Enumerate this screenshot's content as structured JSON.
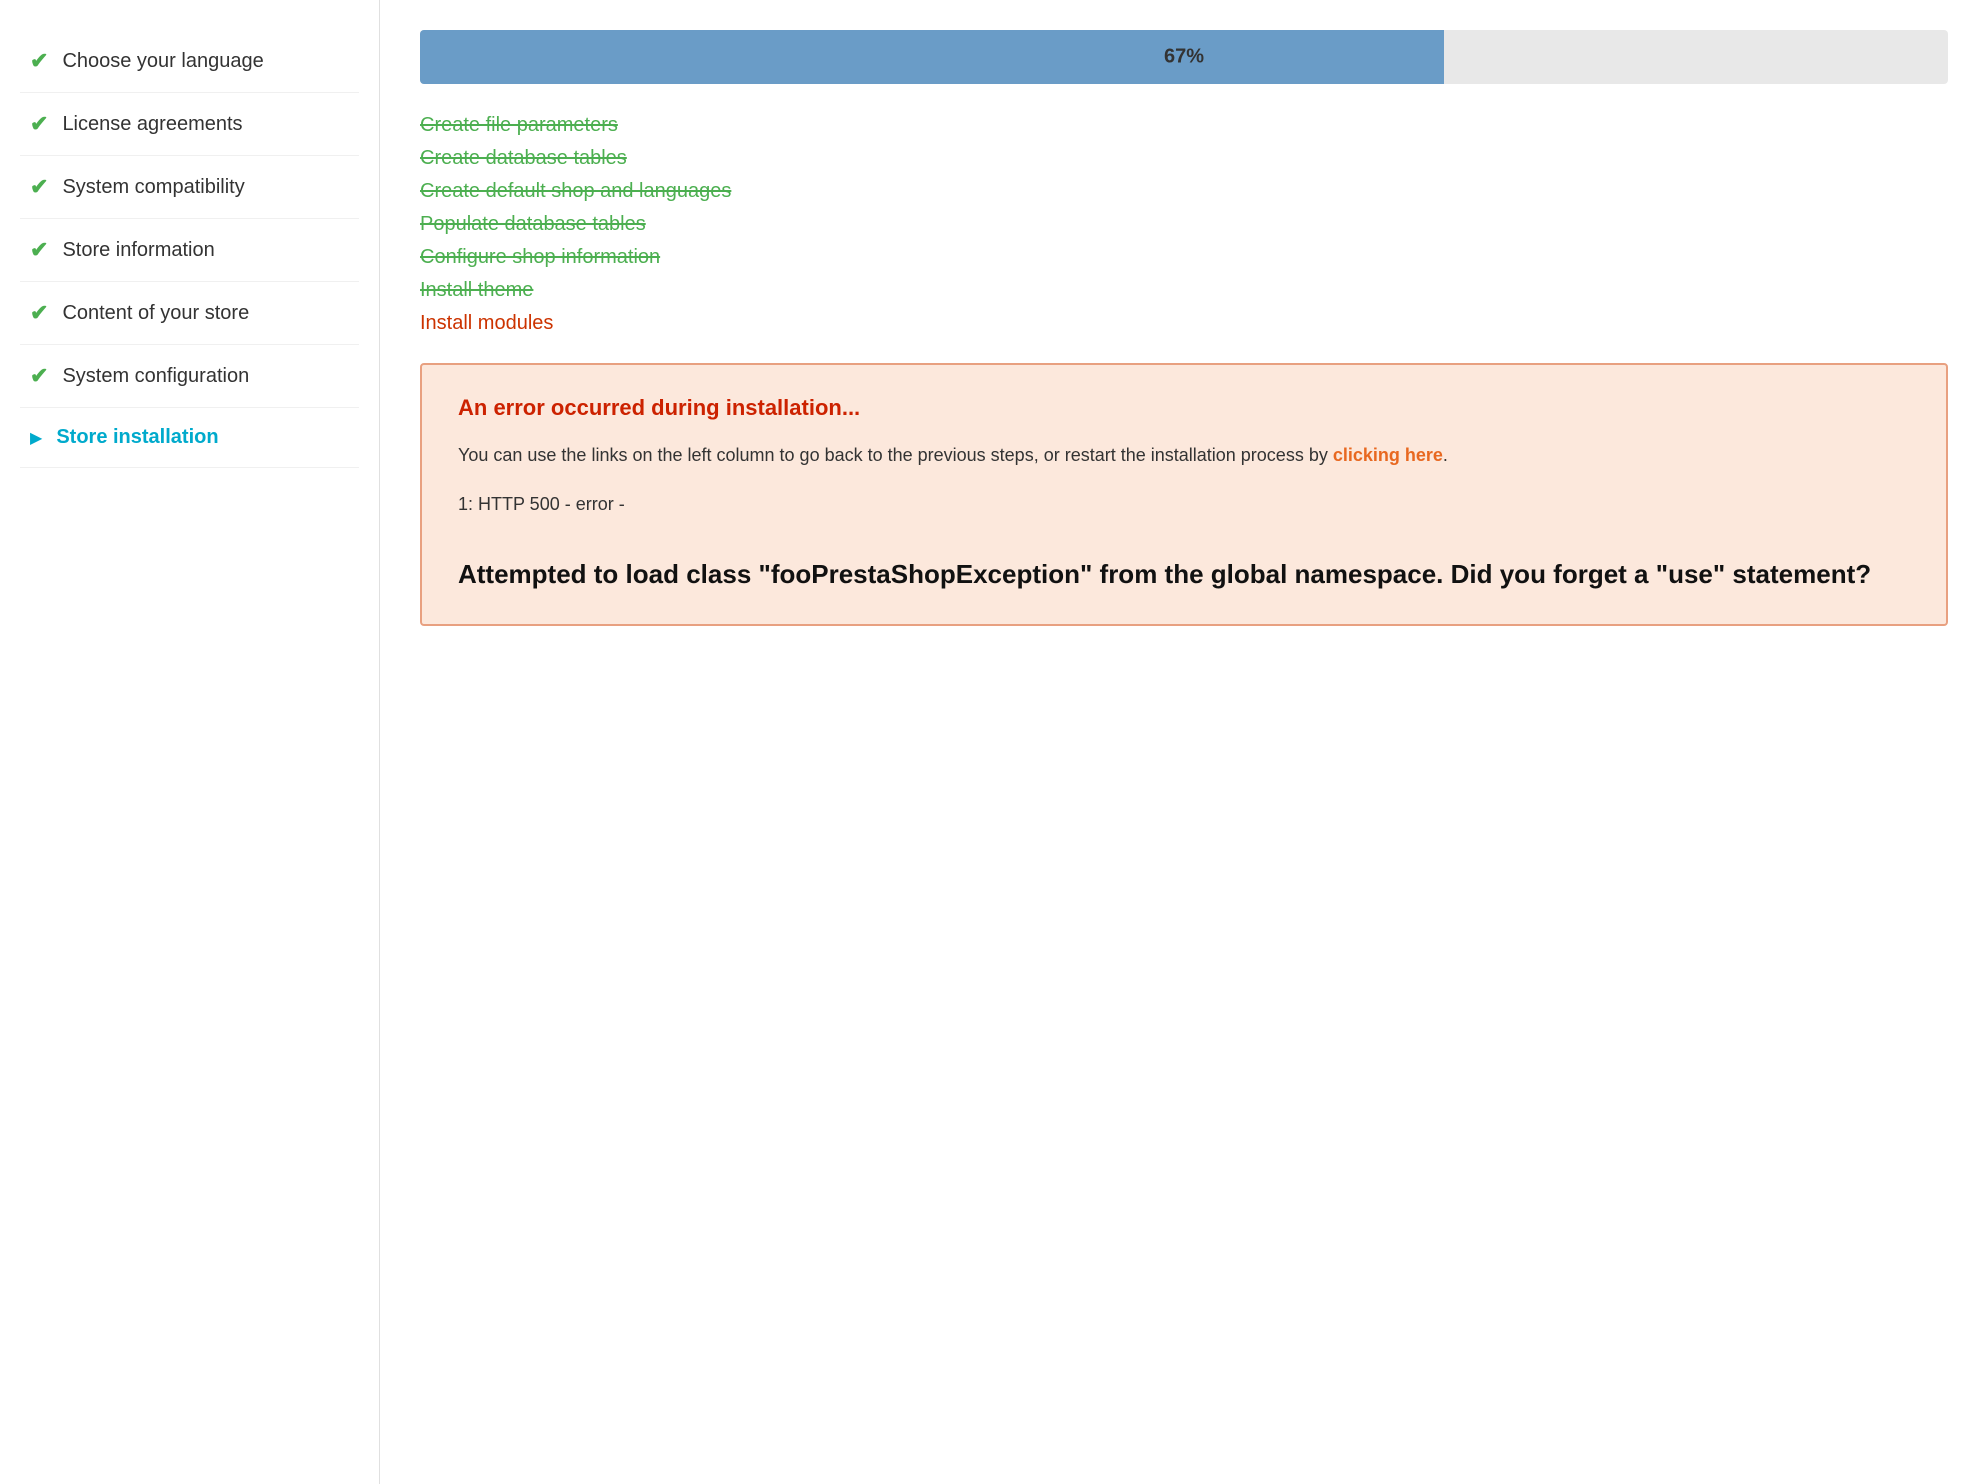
{
  "sidebar": {
    "items": [
      {
        "id": "choose-language",
        "label": "Choose your language",
        "status": "done",
        "active": false
      },
      {
        "id": "license-agreements",
        "label": "License agreements",
        "status": "done",
        "active": false
      },
      {
        "id": "system-compatibility",
        "label": "System compatibility",
        "status": "done",
        "active": false
      },
      {
        "id": "store-information",
        "label": "Store information",
        "status": "done",
        "active": false
      },
      {
        "id": "content-of-your-store",
        "label": "Content of your store",
        "status": "done",
        "active": false
      },
      {
        "id": "system-configuration",
        "label": "System configuration",
        "status": "done",
        "active": false
      },
      {
        "id": "store-installation",
        "label": "Store installation",
        "status": "active",
        "active": true
      }
    ],
    "check_symbol": "✔",
    "arrow_symbol": "▶"
  },
  "progress": {
    "percent": 67,
    "label": "67%",
    "width_percent": 67
  },
  "steps": [
    {
      "id": "create-file-parameters",
      "label": "Create file parameters",
      "done": true
    },
    {
      "id": "create-database-tables",
      "label": "Create database tables",
      "done": true
    },
    {
      "id": "create-default-shop",
      "label": "Create default shop and languages",
      "done": true
    },
    {
      "id": "populate-database-tables",
      "label": "Populate database tables",
      "done": true
    },
    {
      "id": "configure-shop-information",
      "label": "Configure shop information",
      "done": true
    },
    {
      "id": "install-theme",
      "label": "Install theme",
      "done": true
    },
    {
      "id": "install-modules",
      "label": "Install modules",
      "done": false,
      "current": true
    }
  ],
  "error": {
    "title": "An error occurred during installation...",
    "body_text": "You can use the links on the left column to go back to the previous steps, or restart the installation process by ",
    "link_label": "clicking here",
    "body_suffix": ".",
    "error_code": "1: HTTP 500 - error -",
    "exception_text": "Attempted to load class \"fooPrestaShopException\"\nfrom the global namespace.\nDid you forget a \"use\" statement?"
  },
  "colors": {
    "accent": "#00aacc",
    "progress_fill": "#6a9cc7",
    "done_green": "#4caf50",
    "error_red": "#cc2200",
    "error_bg": "#fce8dc",
    "error_border": "#e8a080",
    "current_red": "#cc3300",
    "link_orange": "#e86820"
  }
}
